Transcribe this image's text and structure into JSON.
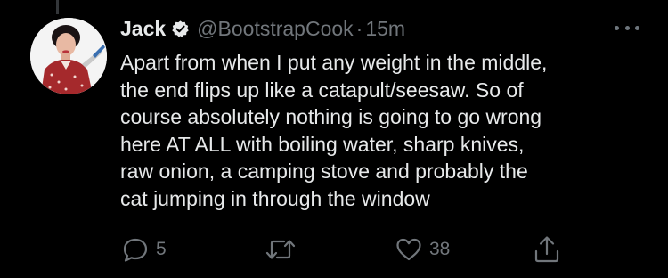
{
  "tweet": {
    "display_name": "Jack",
    "handle": "@BootstrapCook",
    "separator": "·",
    "time": "15m",
    "text": "Apart from when I put any weight in the middle,\nthe end flips up like a catapult/seesaw. So of\ncourse absolutely nothing is going to go wrong\nhere AT ALL with boiling water, sharp knives,\nraw onion, a camping stove and probably the\ncat jumping in through the window",
    "verified_icon": "verified-badge-icon",
    "more_icon": "more-options-icon"
  },
  "actions": {
    "reply_count": "5",
    "retweet_count": "",
    "like_count": "38",
    "icons": [
      "reply-icon",
      "retweet-icon",
      "like-icon",
      "share-icon"
    ]
  },
  "colors": {
    "background": "#000000",
    "text": "#e7e9ea",
    "secondary": "#71767b"
  }
}
